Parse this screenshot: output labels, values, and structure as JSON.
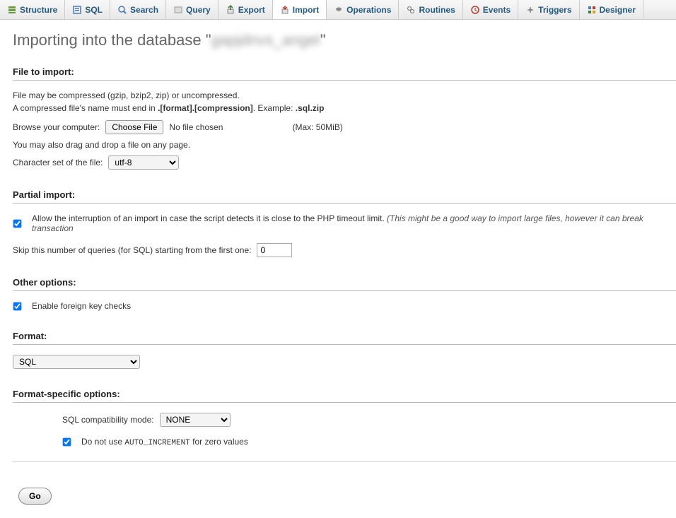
{
  "tabs": [
    {
      "label": "Structure",
      "icon": "structure"
    },
    {
      "label": "SQL",
      "icon": "sql"
    },
    {
      "label": "Search",
      "icon": "search"
    },
    {
      "label": "Query",
      "icon": "query"
    },
    {
      "label": "Export",
      "icon": "export"
    },
    {
      "label": "Import",
      "icon": "import"
    },
    {
      "label": "Operations",
      "icon": "operations"
    },
    {
      "label": "Routines",
      "icon": "routines"
    },
    {
      "label": "Events",
      "icon": "events"
    },
    {
      "label": "Triggers",
      "icon": "triggers"
    },
    {
      "label": "Designer",
      "icon": "designer"
    }
  ],
  "active_tab_index": 5,
  "heading_prefix": "Importing into the database \"",
  "heading_dbname": "gapjdnvs_angel",
  "heading_suffix": "\"",
  "file_section": {
    "title": "File to import:",
    "line1": "File may be compressed (gzip, bzip2, zip) or uncompressed.",
    "line2_prefix": "A compressed file's name must end in ",
    "line2_bold1": ".[format].[compression]",
    "line2_mid": ". Example: ",
    "line2_bold2": ".sql.zip",
    "browse_label": "Browse your computer:",
    "choose_file": "Choose File",
    "no_file": "No file chosen",
    "max_size": "(Max: 50MiB)",
    "drag_drop": "You may also drag and drop a file on any page.",
    "charset_label": "Character set of the file:",
    "charset_value": "utf-8"
  },
  "partial_section": {
    "title": "Partial import:",
    "allow_interrupt_checked": true,
    "allow_interrupt_label": "Allow the interruption of an import in case the script detects it is close to the PHP timeout limit.",
    "allow_interrupt_italic": "(This might be a good way to import large files, however it can break transaction",
    "skip_label": "Skip this number of queries (for SQL) starting from the first one:",
    "skip_value": "0"
  },
  "other_section": {
    "title": "Other options:",
    "fk_checked": true,
    "fk_label": "Enable foreign key checks"
  },
  "format_section": {
    "title": "Format:",
    "value": "SQL"
  },
  "format_specific": {
    "title": "Format-specific options:",
    "compat_label": "SQL compatibility mode:",
    "compat_value": "NONE",
    "auto_inc_checked": true,
    "auto_inc_prefix": "Do not use ",
    "auto_inc_code": "AUTO_INCREMENT",
    "auto_inc_suffix": " for zero values"
  },
  "go_label": "Go"
}
